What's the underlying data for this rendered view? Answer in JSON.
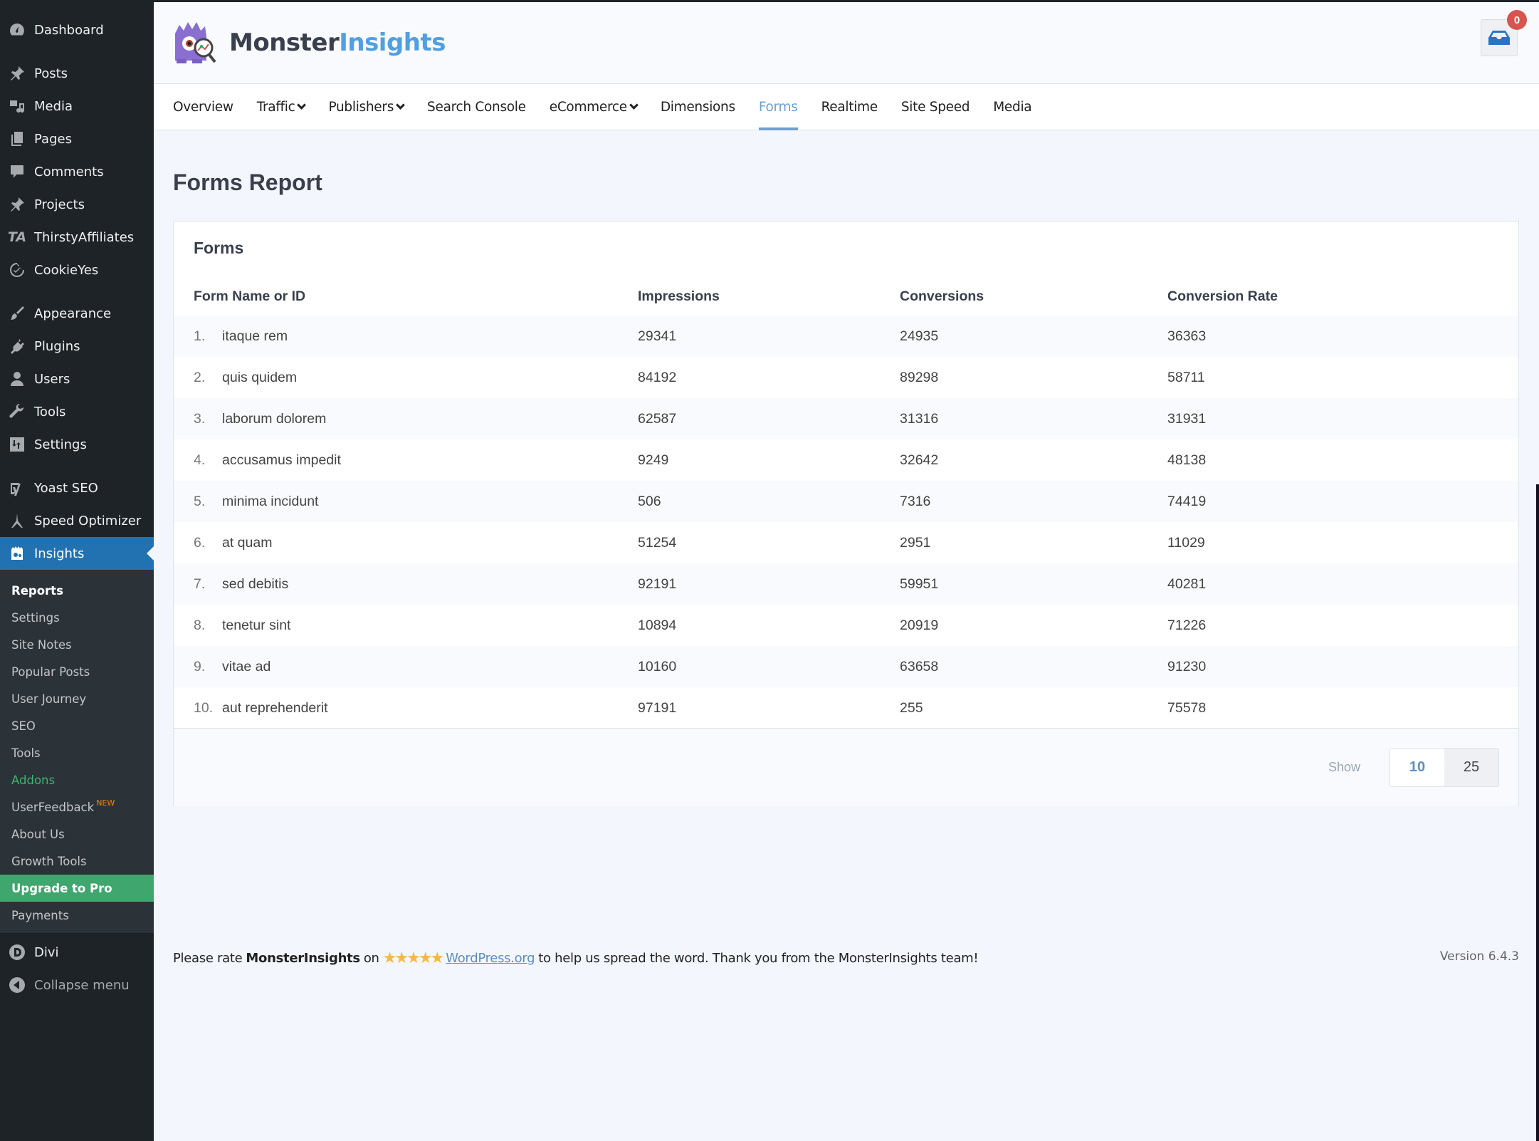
{
  "sidebar": {
    "items": [
      {
        "label": "Dashboard",
        "icon": "dashboard-icon"
      },
      {
        "label": "Posts",
        "icon": "pin-icon"
      },
      {
        "label": "Media",
        "icon": "media-icon"
      },
      {
        "label": "Pages",
        "icon": "pages-icon"
      },
      {
        "label": "Comments",
        "icon": "comment-icon"
      },
      {
        "label": "Projects",
        "icon": "pin-icon"
      },
      {
        "label": "ThirstyAffiliates",
        "icon": "ta-icon"
      },
      {
        "label": "CookieYes",
        "icon": "cookie-icon"
      },
      {
        "label": "Appearance",
        "icon": "brush-icon"
      },
      {
        "label": "Plugins",
        "icon": "plug-icon"
      },
      {
        "label": "Users",
        "icon": "user-icon"
      },
      {
        "label": "Tools",
        "icon": "wrench-icon"
      },
      {
        "label": "Settings",
        "icon": "sliders-icon"
      },
      {
        "label": "Yoast SEO",
        "icon": "yoast-icon"
      },
      {
        "label": "Speed Optimizer",
        "icon": "speed-icon"
      },
      {
        "label": "Insights",
        "icon": "monster-icon"
      }
    ],
    "submenu": [
      {
        "label": "Reports"
      },
      {
        "label": "Settings"
      },
      {
        "label": "Site Notes"
      },
      {
        "label": "Popular Posts"
      },
      {
        "label": "User Journey"
      },
      {
        "label": "SEO"
      },
      {
        "label": "Tools"
      },
      {
        "label": "Addons"
      },
      {
        "label": "UserFeedback",
        "badge": "NEW"
      },
      {
        "label": "About Us"
      },
      {
        "label": "Growth Tools"
      },
      {
        "label": "Upgrade to Pro"
      },
      {
        "label": "Payments"
      }
    ],
    "after": [
      {
        "label": "Divi",
        "icon": "divi-icon"
      },
      {
        "label": "Collapse menu",
        "icon": "collapse-icon"
      }
    ]
  },
  "header": {
    "logo_part1": "Monster",
    "logo_part2": "Insights",
    "notification_count": "0"
  },
  "nav": {
    "tabs": [
      {
        "label": "Overview"
      },
      {
        "label": "Traffic",
        "dropdown": true
      },
      {
        "label": "Publishers",
        "dropdown": true
      },
      {
        "label": "Search Console"
      },
      {
        "label": "eCommerce",
        "dropdown": true
      },
      {
        "label": "Dimensions"
      },
      {
        "label": "Forms",
        "active": true
      },
      {
        "label": "Realtime"
      },
      {
        "label": "Site Speed"
      },
      {
        "label": "Media"
      }
    ]
  },
  "main": {
    "title": "Forms Report",
    "card_title": "Forms",
    "columns": [
      "Form Name or ID",
      "Impressions",
      "Conversions",
      "Conversion Rate"
    ],
    "rows": [
      {
        "idx": "1.",
        "name": "itaque rem",
        "impressions": "29341",
        "conversions": "24935",
        "rate": "36363"
      },
      {
        "idx": "2.",
        "name": "quis quidem",
        "impressions": "84192",
        "conversions": "89298",
        "rate": "58711"
      },
      {
        "idx": "3.",
        "name": "laborum dolorem",
        "impressions": "62587",
        "conversions": "31316",
        "rate": "31931"
      },
      {
        "idx": "4.",
        "name": "accusamus impedit",
        "impressions": "9249",
        "conversions": "32642",
        "rate": "48138"
      },
      {
        "idx": "5.",
        "name": "minima incidunt",
        "impressions": "506",
        "conversions": "7316",
        "rate": "74419"
      },
      {
        "idx": "6.",
        "name": "at quam",
        "impressions": "51254",
        "conversions": "2951",
        "rate": "11029"
      },
      {
        "idx": "7.",
        "name": "sed debitis",
        "impressions": "92191",
        "conversions": "59951",
        "rate": "40281"
      },
      {
        "idx": "8.",
        "name": "tenetur sint",
        "impressions": "10894",
        "conversions": "20919",
        "rate": "71226"
      },
      {
        "idx": "9.",
        "name": "vitae ad",
        "impressions": "10160",
        "conversions": "63658",
        "rate": "91230"
      },
      {
        "idx": "10.",
        "name": "aut reprehenderit",
        "impressions": "97191",
        "conversions": "255",
        "rate": "75578"
      }
    ],
    "show_label": "Show",
    "page_sizes": [
      "10",
      "25"
    ],
    "selected_page_size": "10"
  },
  "footer": {
    "text_before": "Please rate",
    "brand": "MonsterInsights",
    "text_on": "on",
    "stars": "★★★★★",
    "link": "WordPress.org",
    "text_after": "to help us spread the word. Thank you from the MonsterInsights team!",
    "version": "Version 6.4.3"
  },
  "colors": {
    "accent": "#6f9fcf",
    "wp_active": "#2271b1",
    "upgrade_green": "#3fa76d",
    "badge_red": "#d9534f",
    "star": "#f7b843"
  }
}
